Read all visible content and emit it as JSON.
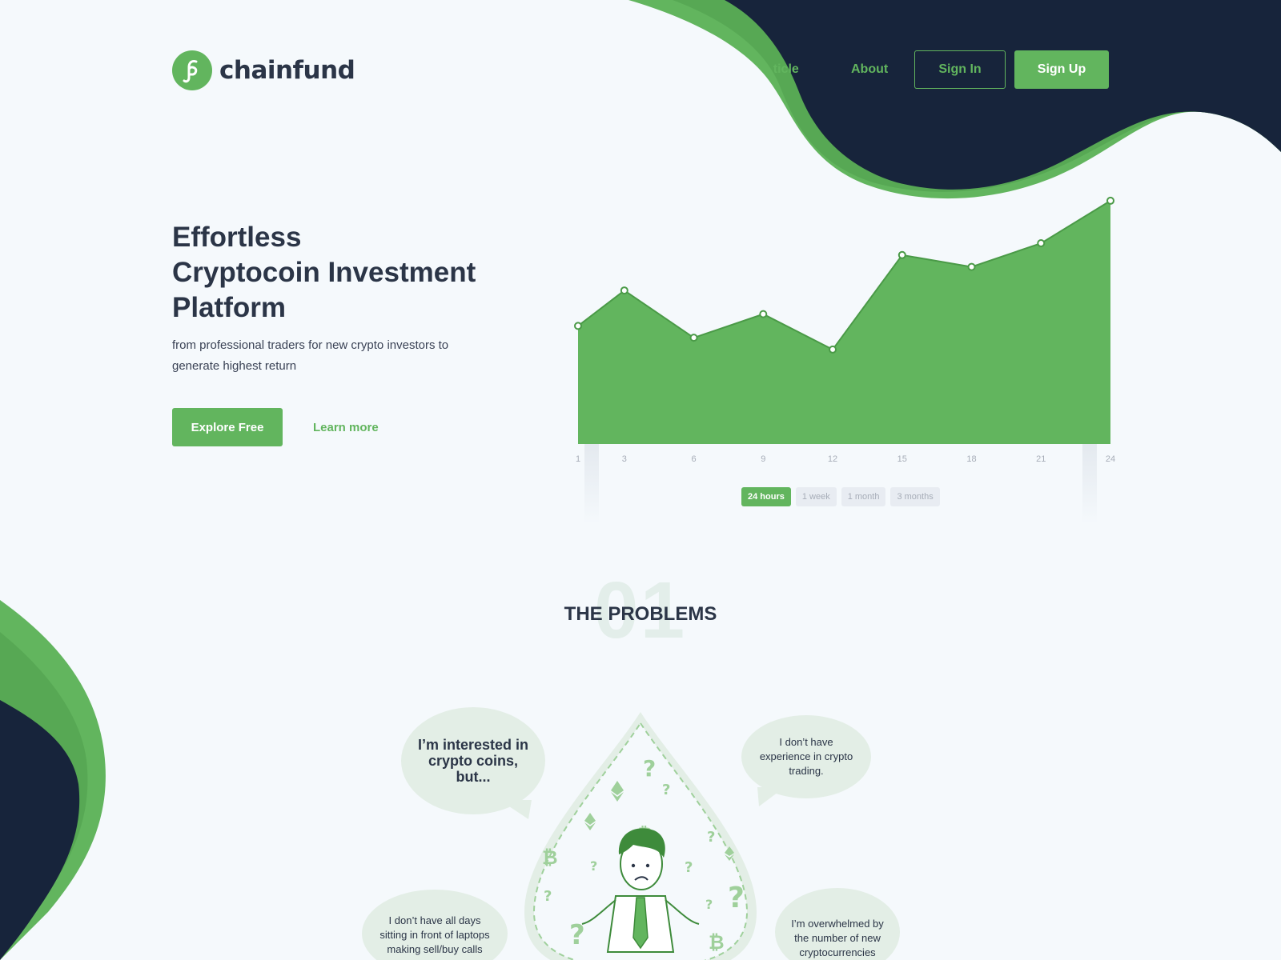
{
  "brand": {
    "name": "chainfund",
    "accent": "#62b55e",
    "dark": "#17243b",
    "text": "#2b3547"
  },
  "nav": {
    "links": [
      {
        "label": "Article"
      },
      {
        "label": "About"
      }
    ],
    "sign_in": "Sign In",
    "sign_up": "Sign Up"
  },
  "hero": {
    "title_lines": [
      "Effortless",
      "Cryptocoin Investment",
      "Platform"
    ],
    "subtitle": "from professional traders for new crypto investors to generate highest return",
    "cta_primary": "Explore Free",
    "cta_secondary": "Learn more"
  },
  "chart_data": {
    "type": "area",
    "title": "",
    "xlabel": "",
    "ylabel": "",
    "x": [
      1,
      3,
      6,
      9,
      12,
      15,
      18,
      21,
      24
    ],
    "values": [
      50,
      65,
      45,
      55,
      40,
      80,
      75,
      85,
      103
    ],
    "ylim": [
      0,
      105
    ],
    "grid": false,
    "color": "#62b55e"
  },
  "time_ranges": [
    {
      "label": "24 hours",
      "active": true
    },
    {
      "label": "1 week",
      "active": false
    },
    {
      "label": "1 month",
      "active": false
    },
    {
      "label": "3 months",
      "active": false
    }
  ],
  "problems": {
    "number": "01",
    "title": "THE PROBLEMS",
    "bubbles": [
      "I’m interested in crypto coins, but...",
      "I don’t have experience in crypto trading.",
      "I don’t have all days sitting in front of laptops making sell/buy calls",
      "I’m overwhelmed by the number of new cryptocurrencies"
    ]
  },
  "icons": [
    "logo-mark-icon",
    "ethereum-icon",
    "bitcoin-icon",
    "question-mark-icon",
    "confused-investor-illustration"
  ]
}
